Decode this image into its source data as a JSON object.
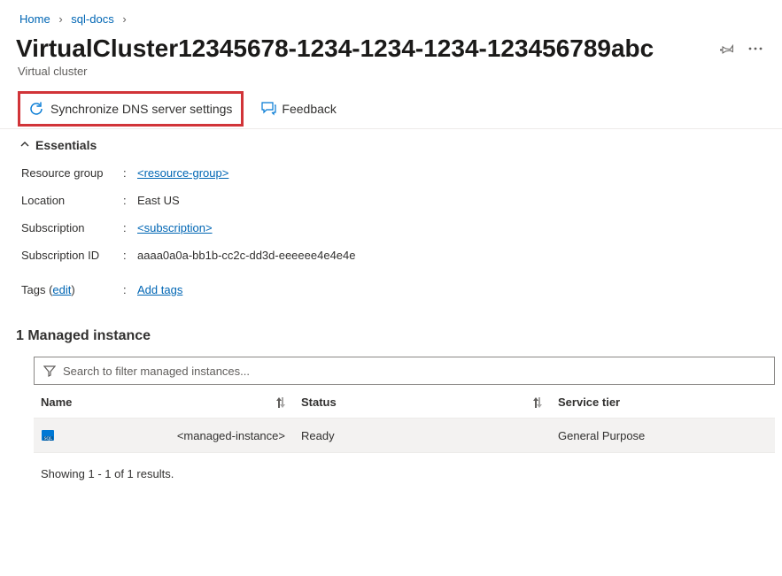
{
  "breadcrumb": {
    "home": "Home",
    "sqldocs": "sql-docs"
  },
  "title": "VirtualCluster12345678-1234-1234-1234-123456789abc",
  "subtitle": "Virtual cluster",
  "toolbar": {
    "sync_label": "Synchronize DNS server settings",
    "feedback_label": "Feedback"
  },
  "essentials": {
    "header": "Essentials",
    "rows": {
      "resource_group_label": "Resource group",
      "resource_group_value": "<resource-group>",
      "location_label": "Location",
      "location_value": "East US",
      "subscription_label": "Subscription",
      "subscription_value": "<subscription>",
      "subscription_id_label": "Subscription ID",
      "subscription_id_value": "aaaa0a0a-bb1b-cc2c-dd3d-eeeeee4e4e4e",
      "tags_label_prefix": "Tags (",
      "tags_edit": "edit",
      "tags_label_suffix": ")",
      "tags_value": "Add tags"
    }
  },
  "section_heading": "1 Managed instance",
  "search": {
    "placeholder": "Search to filter managed instances..."
  },
  "table": {
    "headers": {
      "name": "Name",
      "status": "Status",
      "tier": "Service tier"
    },
    "row": {
      "name": "<managed-instance>",
      "status": "Ready",
      "tier": "General Purpose"
    },
    "results_text": "Showing 1 - 1 of 1 results."
  }
}
